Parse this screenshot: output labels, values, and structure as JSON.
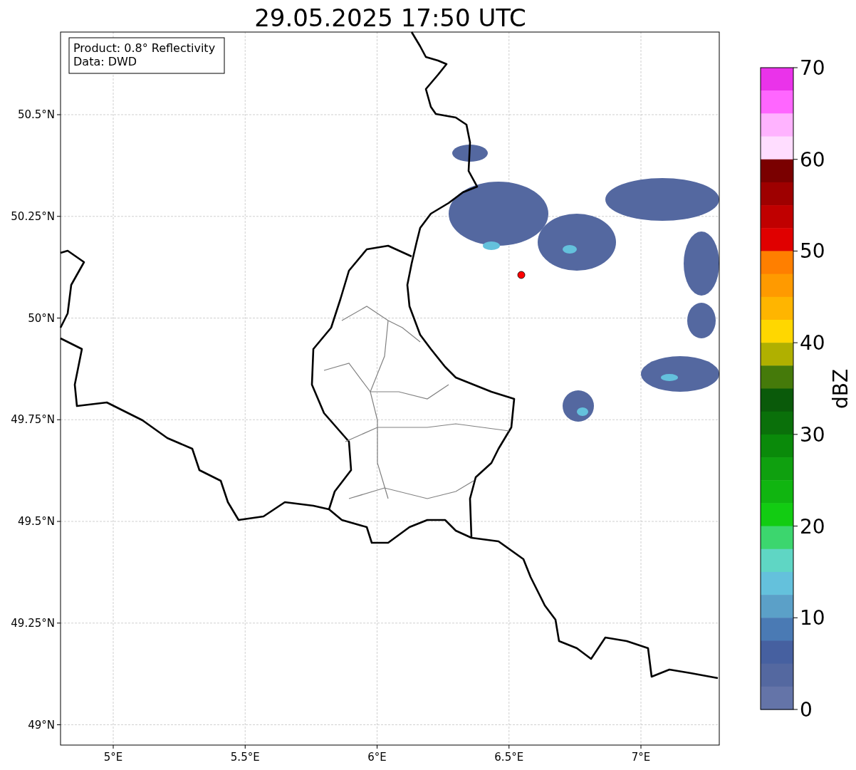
{
  "title": "29.05.2025 17:50 UTC",
  "info_box": [
    "Product: 0.8° Reflectivity",
    "Data: DWD"
  ],
  "map": {
    "x_tick_labels": [
      "5°E",
      "5.5°E",
      "6°E",
      "6.5°E",
      "7°E"
    ],
    "y_tick_labels": [
      "50.5°N",
      "50.25°N",
      "50°N",
      "49.75°N",
      "49.5°N",
      "49.25°N",
      "49°N"
    ]
  },
  "colorbar": {
    "label": "dBZ",
    "tick_labels": [
      "70",
      "60",
      "50",
      "40",
      "30",
      "20",
      "10",
      "0"
    ],
    "bands": [
      {
        "color": "#ea33ea"
      },
      {
        "color": "#ff66ff"
      },
      {
        "color": "#ffb3ff"
      },
      {
        "color": "#ffddff"
      },
      {
        "color": "#7a0000"
      },
      {
        "color": "#9e0000"
      },
      {
        "color": "#c00000"
      },
      {
        "color": "#e00000"
      },
      {
        "color": "#ff7f00"
      },
      {
        "color": "#ff9a00"
      },
      {
        "color": "#ffb500"
      },
      {
        "color": "#ffd700"
      },
      {
        "color": "#b0b000"
      },
      {
        "color": "#457a0a"
      },
      {
        "color": "#0a5a0a"
      },
      {
        "color": "#0a700a"
      },
      {
        "color": "#0a8a0a"
      },
      {
        "color": "#0fa00f"
      },
      {
        "color": "#10b510"
      },
      {
        "color": "#12cc12"
      },
      {
        "color": "#3cd66e"
      },
      {
        "color": "#5fd6c4"
      },
      {
        "color": "#64c1dc"
      },
      {
        "color": "#5ba0c8"
      },
      {
        "color": "#4a7ab4"
      },
      {
        "color": "#4660a0"
      },
      {
        "color": "#5468a0"
      },
      {
        "color": "#6474a8"
      }
    ]
  }
}
